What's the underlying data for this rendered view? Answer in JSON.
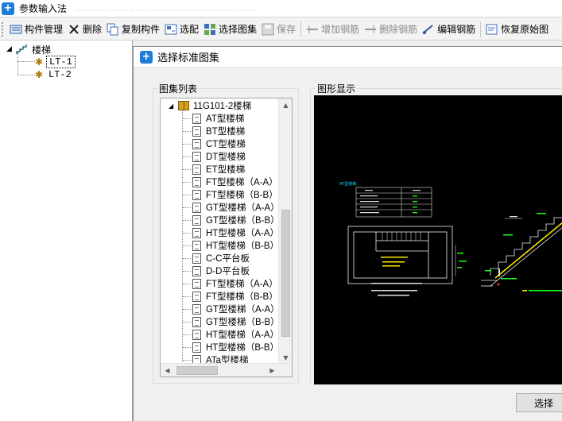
{
  "window": {
    "title": "参数输入法",
    "subtitle_blurred": "……………………………………………………"
  },
  "toolbar": {
    "items": [
      {
        "label": "构件管理",
        "icon": "component-manage-icon",
        "enabled": true
      },
      {
        "label": "删除",
        "icon": "delete-x-icon",
        "enabled": true
      },
      {
        "label": "复制构件",
        "icon": "copy-icon",
        "enabled": true
      },
      {
        "label": "选配",
        "icon": "select-config-icon",
        "enabled": true
      },
      {
        "label": "选择图集",
        "icon": "atlas-icon",
        "enabled": true
      },
      {
        "label": "保存",
        "icon": "save-icon",
        "enabled": false
      },
      {
        "label": "增加钢筋",
        "icon": "add-rebar-icon",
        "enabled": false
      },
      {
        "label": "删除钢筋",
        "icon": "delete-rebar-icon",
        "enabled": false
      },
      {
        "label": "编辑钢筋",
        "icon": "edit-rebar-icon",
        "enabled": true
      },
      {
        "label": "恢复原始图",
        "icon": "restore-icon",
        "enabled": true
      }
    ]
  },
  "component_tree": {
    "root": "楼梯",
    "children": [
      "LT-1",
      "LT-2"
    ],
    "selected": "LT-1"
  },
  "dialog": {
    "title": "选择标准图集",
    "list_group_label": "图集列表",
    "preview_group_label": "图形显示",
    "select_button": "选择",
    "atlas_root": "11G101-2楼梯",
    "atlas_items": [
      "AT型楼梯",
      "BT型楼梯",
      "CT型楼梯",
      "DT型楼梯",
      "ET型楼梯",
      "FT型楼梯（A-A）",
      "FT型楼梯（B-B）",
      "GT型楼梯（A-A）",
      "GT型楼梯（B-B）",
      "HT型楼梯（A-A）",
      "HT型楼梯（B-B）",
      "C-C平台板",
      "D-D平台板",
      "FT型楼梯（A-A）",
      "FT型楼梯（B-B）",
      "GT型楼梯（A-A）",
      "GT型楼梯（B-B）",
      "HT型楼梯（A-A）",
      "HT型楼梯（B-B）",
      "ATa型楼梯"
    ]
  },
  "colors": {
    "accent": "#1c7ed6",
    "preview_bg": "#000000",
    "cad_cyan": "#00d8ff",
    "cad_green": "#19ff19",
    "cad_white": "#ffffff",
    "cad_yellow": "#ffea00"
  }
}
